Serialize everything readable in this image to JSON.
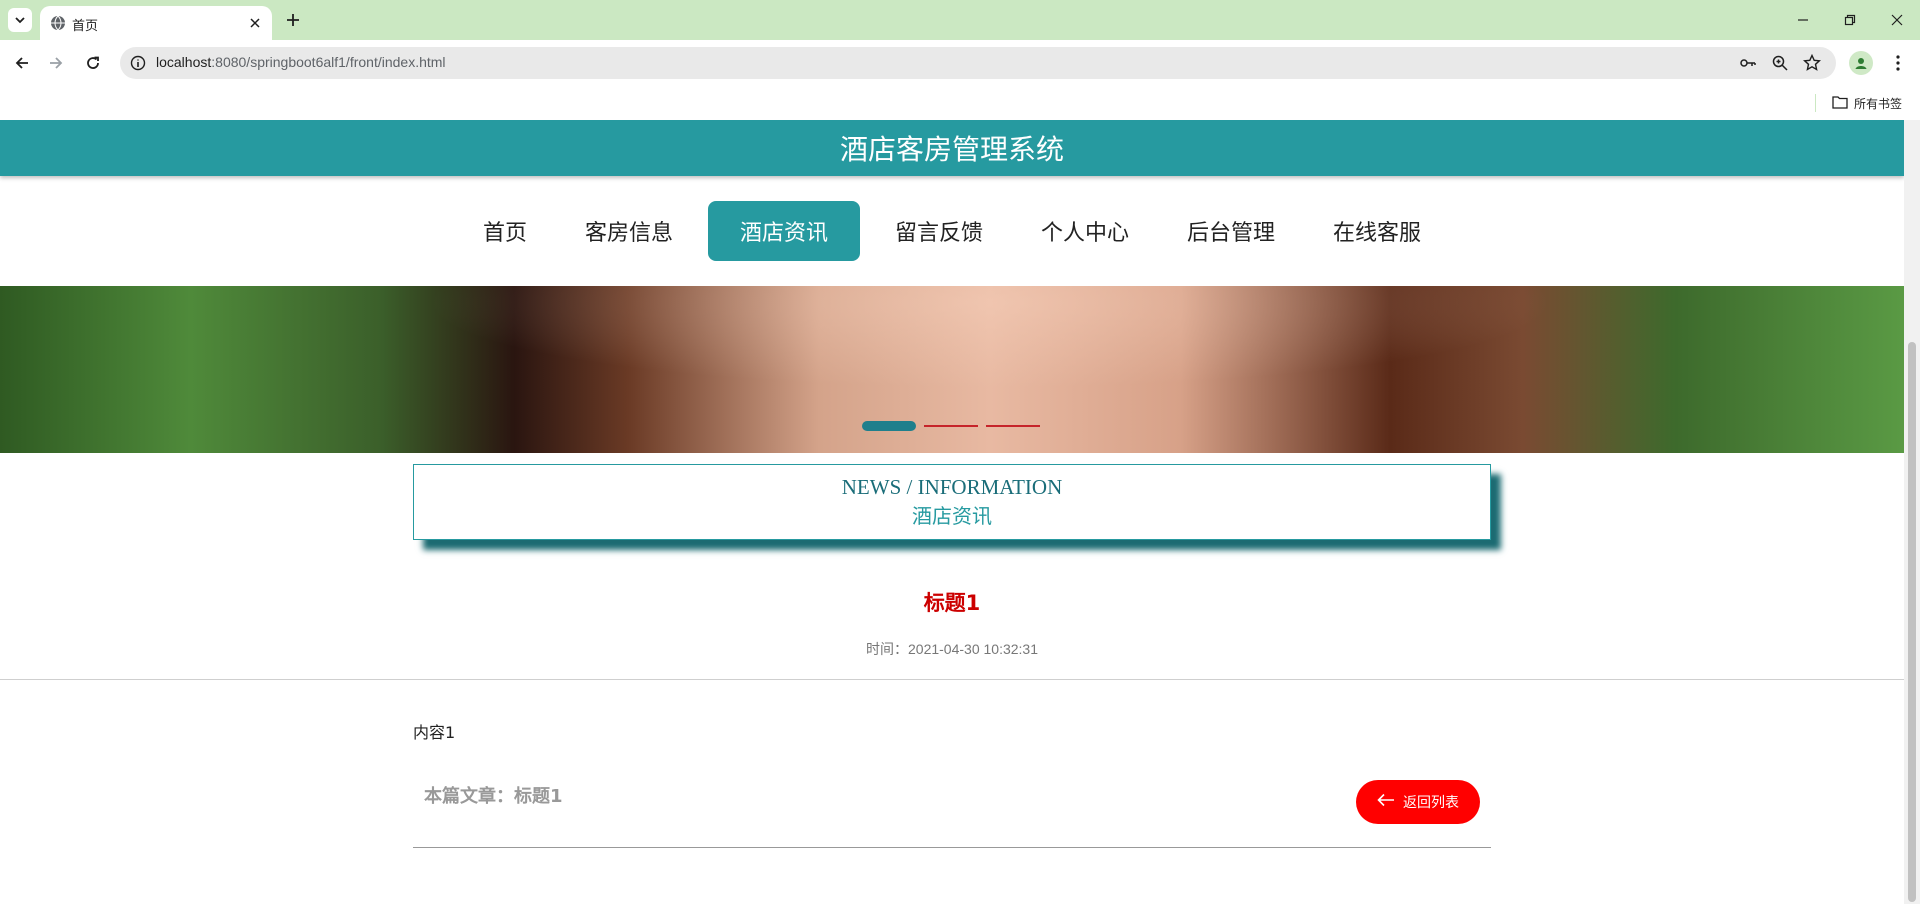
{
  "browser": {
    "tab_title": "首页",
    "url_host": "localhost",
    "url_path": ":8080/springboot6alf1/front/index.html",
    "bookmarks_folder": "所有书签"
  },
  "site": {
    "title": "酒店客房管理系统",
    "accent_color": "#269aa0"
  },
  "nav": {
    "items": [
      {
        "label": "首页"
      },
      {
        "label": "客房信息"
      },
      {
        "label": "酒店资讯",
        "active": true
      },
      {
        "label": "留言反馈"
      },
      {
        "label": "个人中心"
      },
      {
        "label": "后台管理"
      },
      {
        "label": "在线客服"
      }
    ]
  },
  "banner": {
    "slide_count": 3,
    "active_slide": 1
  },
  "section": {
    "title_en": "NEWS / INFORMATION",
    "title_cn": "酒店资讯"
  },
  "article": {
    "title": "标题1",
    "time": "时间：2021-04-30 10:32:31",
    "content": "内容1",
    "current_label": "本篇文章：标题1",
    "back_button": "返回列表",
    "title_color": "#cc0000",
    "button_color": "#ff0000"
  }
}
